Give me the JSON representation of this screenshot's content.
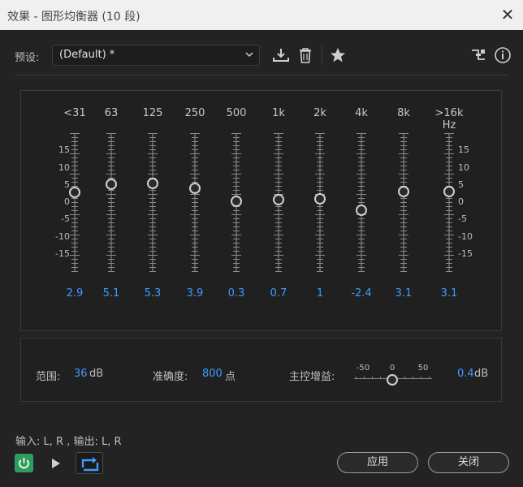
{
  "window": {
    "title": "效果 - 图形均衡器 (10 段)",
    "close_glyph": "✕"
  },
  "preset": {
    "label": "预设:",
    "value": "(Default) *"
  },
  "toolbar_icons": [
    "download-icon",
    "trash-icon",
    "star-icon",
    "routing-icon",
    "info-icon"
  ],
  "eq": {
    "bands": [
      {
        "freq": "<31",
        "value": "2.9"
      },
      {
        "freq": "63",
        "value": "5.1"
      },
      {
        "freq": "125",
        "value": "5.3"
      },
      {
        "freq": "250",
        "value": "3.9"
      },
      {
        "freq": "500",
        "value": "0.3"
      },
      {
        "freq": "1k",
        "value": "0.7"
      },
      {
        "freq": "2k",
        "value": "1"
      },
      {
        "freq": "4k",
        "value": "-2.4"
      },
      {
        "freq": "8k",
        "value": "3.1"
      },
      {
        "freq": ">16k Hz",
        "value": "3.1"
      }
    ],
    "scale_labels": [
      "15",
      "10",
      "5",
      "0",
      "-5",
      "-10",
      "-15"
    ],
    "range_db": [
      -20,
      20
    ]
  },
  "range": {
    "label": "范围:",
    "value": "36",
    "unit": "dB"
  },
  "accuracy": {
    "label": "准确度:",
    "value": "800",
    "unit": "点"
  },
  "master_gain": {
    "label": "主控增益:",
    "scale": [
      "-50",
      "0",
      "50"
    ],
    "value": "0.4",
    "unit": "dB"
  },
  "io": {
    "text": "输入: L, R ,  输出: L, R"
  },
  "buttons": {
    "apply": "应用",
    "close": "关闭"
  },
  "colors": {
    "accent": "#3d9bff",
    "power_on": "#2f9e5a",
    "background": "#232323"
  }
}
